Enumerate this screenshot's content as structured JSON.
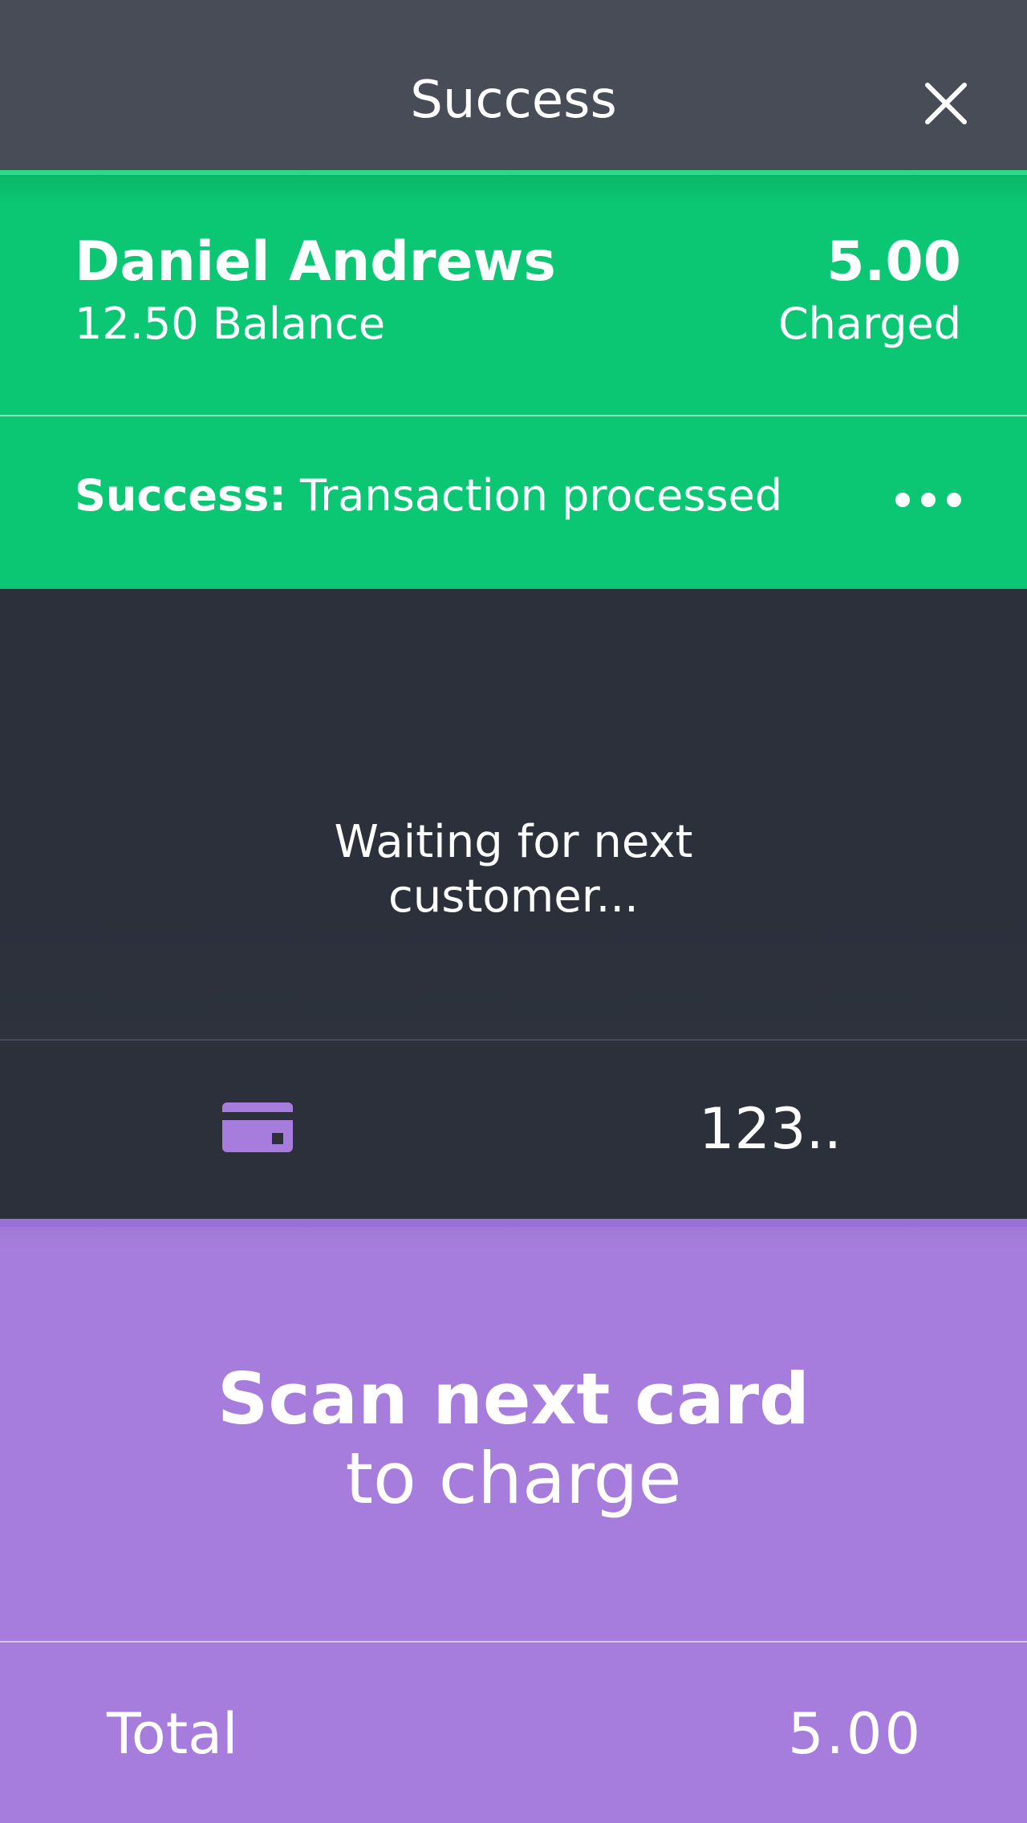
{
  "header": {
    "title": "Success"
  },
  "customer": {
    "name": "Daniel Andrews",
    "balance": "12.50 Balance",
    "amount": "5.00",
    "amount_label": "Charged"
  },
  "status": {
    "prefix": "Success:",
    "message": " Transaction processed"
  },
  "waiting": {
    "line1": "Waiting for next",
    "line2": "customer..."
  },
  "mode_bar": {
    "card_icon": "credit-card-icon",
    "number_label": "123.."
  },
  "scan": {
    "title": "Scan next card",
    "subtitle": "to charge"
  },
  "total": {
    "label": "Total",
    "value": "5.00"
  },
  "colors": {
    "header": "#474c57",
    "success": "#0bc774",
    "dark": "#2b303b",
    "accent": "#a67ddc"
  }
}
